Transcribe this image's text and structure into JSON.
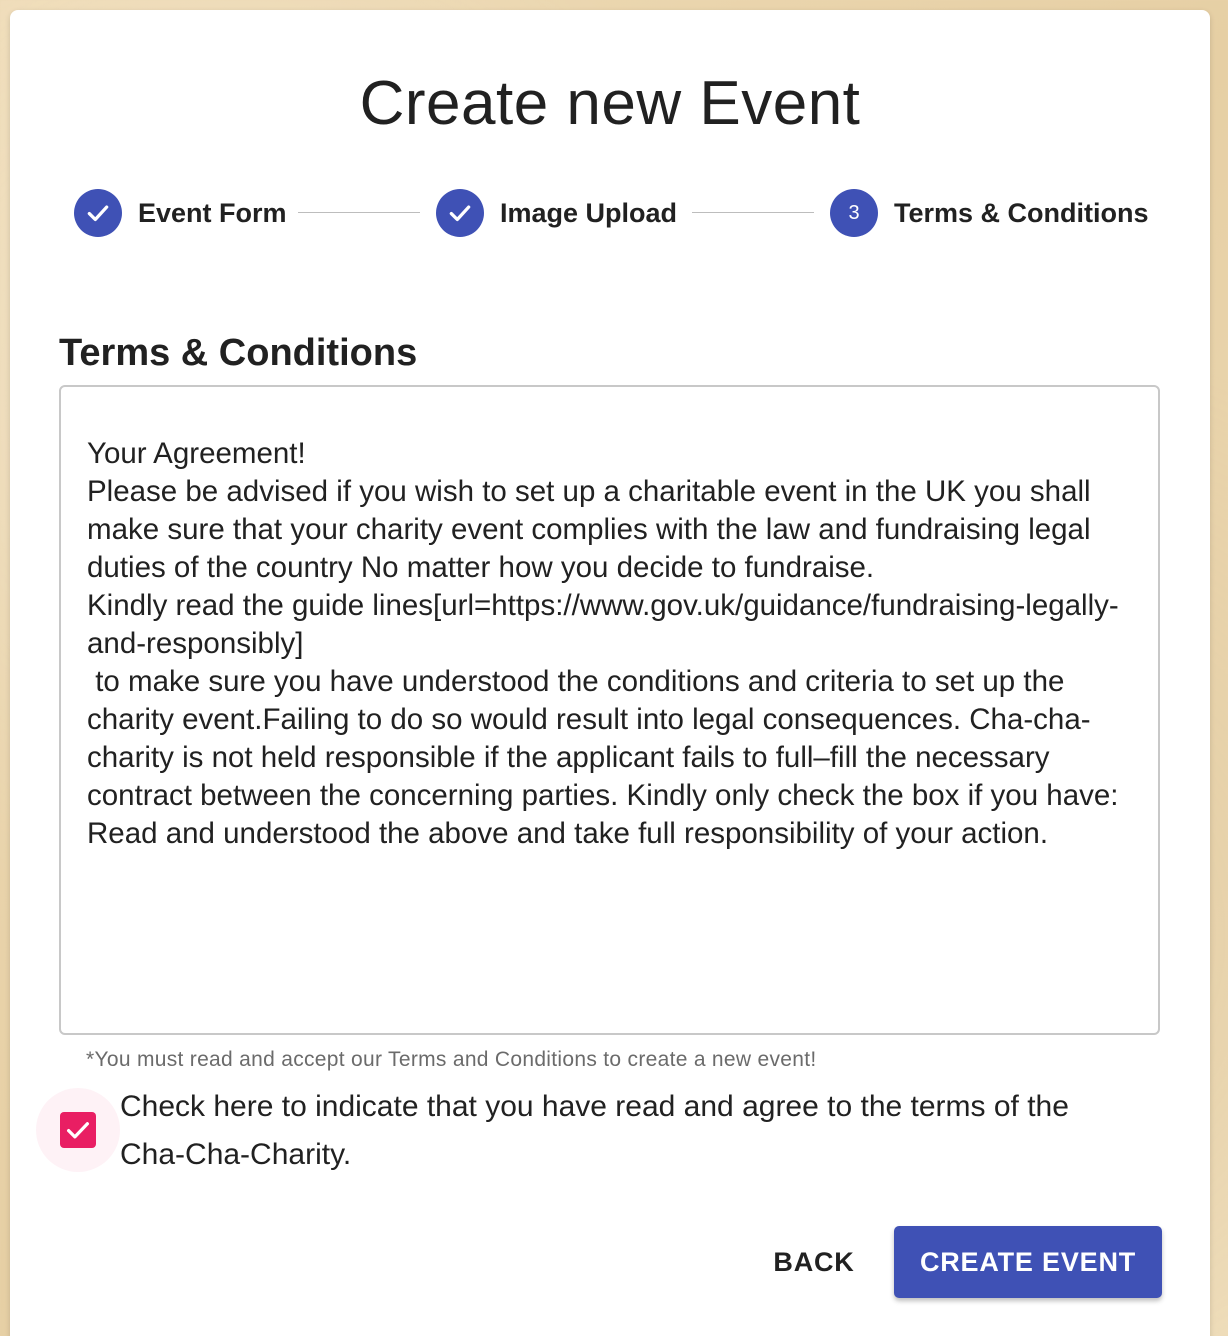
{
  "page": {
    "title": "Create new Event"
  },
  "stepper": {
    "steps": [
      {
        "label": "Event Form",
        "state": "completed",
        "icon": "check-icon"
      },
      {
        "label": "Image Upload",
        "state": "completed",
        "icon": "check-icon"
      },
      {
        "label": "Terms & Conditions",
        "state": "active",
        "number": "3"
      }
    ],
    "accent_color": "#3f51b5"
  },
  "terms": {
    "heading": "Terms & Conditions",
    "body": "Your Agreement!\nPlease be advised if you wish to set up a charitable event in the UK you shall make sure that your charity event complies with the law and fundraising legal duties of the country No matter how you decide to fundraise.\nKindly read the guide lines[url=https://www.gov.uk/guidance/fundraising-legally-and-responsibly]\n to make sure you have understood the conditions and criteria to set up the charity event.Failing to do so would result into legal consequences. Cha-cha-charity is not held responsible if the applicant fails to full–fill the necessary contract between the concerning parties. Kindly only check the box if you have: Read and understood the above and take full responsibility of your action.",
    "helper_text": "*You must read and accept our Terms and Conditions to create a new event!"
  },
  "agreement": {
    "checked": true,
    "label": "Check here to indicate that you have read and agree to the terms of the Cha-Cha-Charity.",
    "checkbox_color": "#e91e63"
  },
  "actions": {
    "back_label": "BACK",
    "create_label": "CREATE EVENT",
    "primary_color": "#3f51b5"
  }
}
